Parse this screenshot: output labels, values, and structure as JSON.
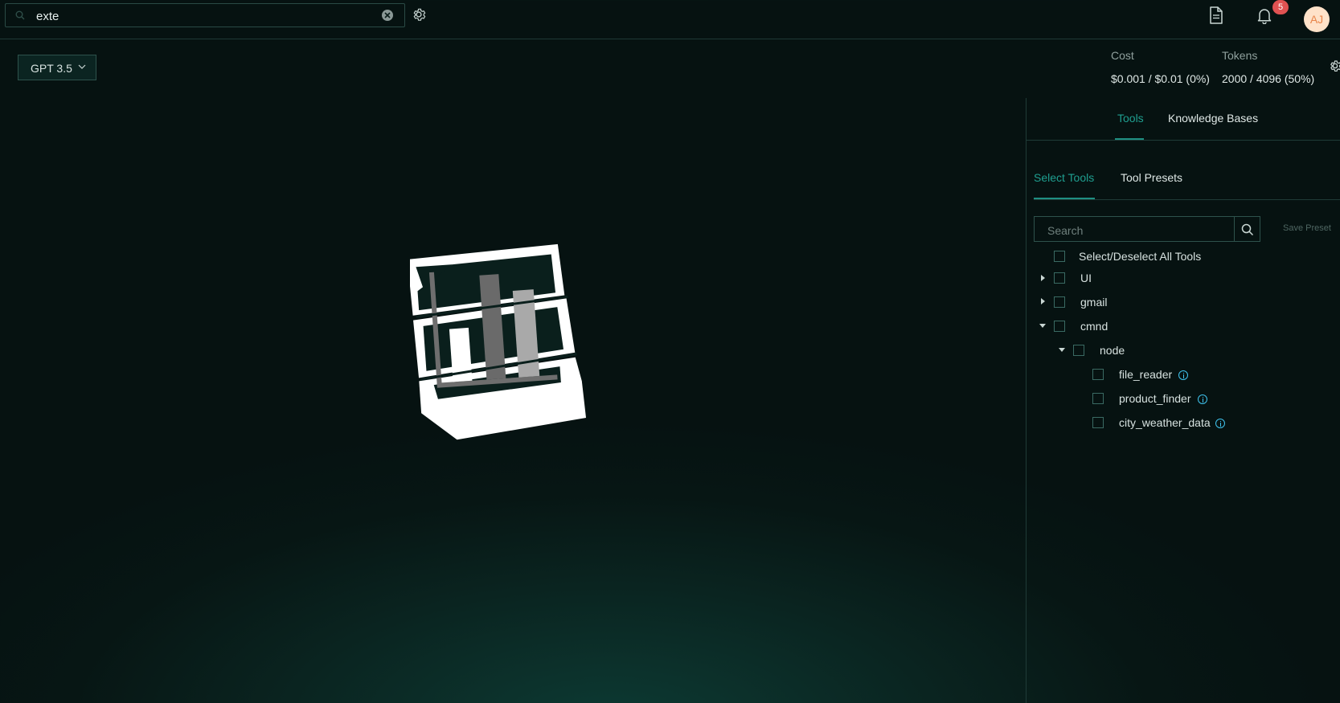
{
  "header": {
    "search_value": "exte",
    "notification_count": "5",
    "avatar_initials": "AJ"
  },
  "model": {
    "selected": "GPT 3.5"
  },
  "stats": {
    "cost_label": "Cost",
    "cost_value": "$0.001 / $0.01 (0%)",
    "tokens_label": "Tokens",
    "tokens_value": "2000 / 4096 (50%)"
  },
  "panel": {
    "tabs": [
      "Tools",
      "Knowledge Bases"
    ],
    "active_tab": "Tools",
    "subtabs": [
      "Select Tools",
      "Tool Presets"
    ],
    "active_subtab": "Select Tools",
    "search_placeholder": "Search",
    "save_preset_label": "Save Preset",
    "select_all_label": "Select/Deselect All Tools",
    "tree": {
      "groups": [
        "UI",
        "gmail",
        "cmnd"
      ],
      "subgroup": "node",
      "tools": [
        "file_reader",
        "product_finder",
        "city_weather_data"
      ]
    }
  },
  "colors": {
    "accent": "#1f8f82",
    "badge": "#e05252",
    "info": "#3fc3ee",
    "avatar_bg": "#ffe2c9"
  },
  "icons": [
    "search-icon",
    "clear-icon",
    "gear-icon",
    "document-icon",
    "bell-icon",
    "chevron-down-icon",
    "info-icon",
    "caret-right-icon",
    "caret-down-icon"
  ]
}
